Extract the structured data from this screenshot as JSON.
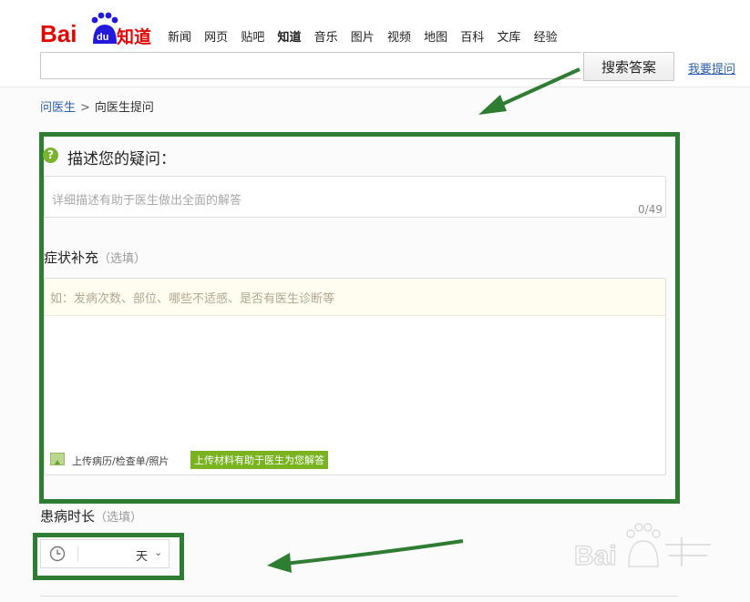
{
  "header": {
    "nav": [
      "新闻",
      "网页",
      "贴吧",
      "知道",
      "音乐",
      "图片",
      "视频",
      "地图",
      "百科",
      "文库",
      "经验"
    ],
    "active_nav": "知道",
    "search_value": "",
    "search_button": "搜索答案",
    "ask_link": "我要提问"
  },
  "breadcrumb": {
    "parent": "问医生",
    "separator": ">",
    "current": "向医生提问"
  },
  "question": {
    "icon_text": "?",
    "title": "描述您的疑问：",
    "placeholder": "详细描述有助于医生做出全面的解答",
    "counter": "0/49"
  },
  "symptom": {
    "label": "症状补充",
    "optional": "（选填）",
    "placeholder": "如：发病次数、部位、哪些不适感、是否有医生诊断等",
    "upload_label": "上传病历/检查单/照片",
    "upload_tip": "上传材料有助于医生为您解答"
  },
  "duration": {
    "label": "患病时长",
    "optional": "（选填）",
    "unit": "天"
  },
  "icons": {
    "question": "question-circle-icon",
    "upload": "image-upload-icon",
    "clock": "clock-icon",
    "chevron": "chevron-down-icon"
  },
  "colors": {
    "annotation_green": "#2e7d32",
    "accent_green": "#79b31f",
    "link_blue": "#2a5caa"
  }
}
